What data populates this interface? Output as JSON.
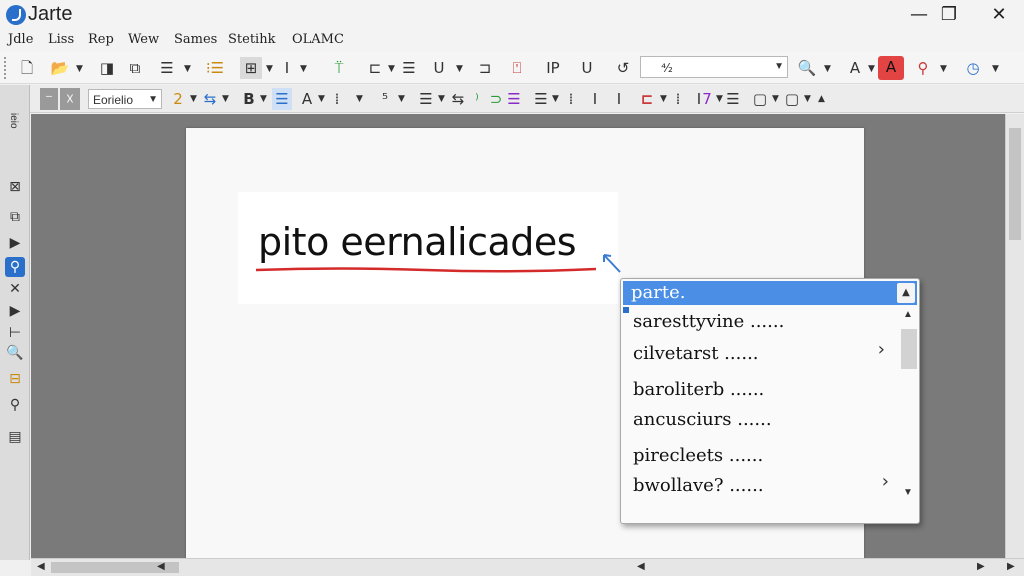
{
  "window": {
    "title": "Jarte",
    "minimize_glyph": "—",
    "maximize_glyph": "❐",
    "close_glyph": "✕"
  },
  "menu": [
    "Jdle",
    "Liss",
    "Rep",
    "Wew",
    "Sames",
    "Stetihk",
    "OLAMC"
  ],
  "toolbar1": {
    "font_combo_value": "",
    "tool_glyphs": [
      "🗋",
      "📂",
      "◨",
      "⧉",
      "☰",
      "⁝☰",
      "⊞",
      "I",
      "⍡",
      "⊏",
      "☰",
      "U",
      "⊐",
      "⍞",
      "IP",
      "U",
      "↺",
      "⁴⁄₂",
      "🔍",
      "A",
      "A",
      "⚲",
      "◷"
    ]
  },
  "toolbar2": {
    "style_combo_value": "Eorielio",
    "tool_glyphs": [
      "⁻",
      "☓",
      "2",
      "⇆",
      "B",
      "☰",
      "A",
      "⁞",
      "⁵",
      "☰",
      "⇆",
      "⁾",
      "⊃",
      "☰",
      "☰",
      "⁞",
      "I",
      "I",
      "⊏",
      "⁞",
      "I",
      "7",
      "☰",
      "▢"
    ]
  },
  "leftbar": {
    "vertical_label": "ieio",
    "tool_glyphs": [
      "⊠",
      "⧉",
      "▶",
      "⚲",
      "✕",
      "▶",
      "⊢",
      "🔍",
      "⊟",
      "⚲",
      "▤"
    ]
  },
  "document": {
    "misspelled_text": "pito eernalicades"
  },
  "suggestions": {
    "selected": "parte.",
    "items": [
      {
        "label": "saresttyvine ......",
        "has_submenu": false
      },
      {
        "label": "cilvetarst ......",
        "has_submenu": true
      },
      {
        "label": "baroliterb ......",
        "has_submenu": false
      },
      {
        "label": "ancusciurs ......",
        "has_submenu": false
      },
      {
        "label": "pirecleets ......",
        "has_submenu": false
      },
      {
        "label": "bwollave? ......",
        "has_submenu": true
      }
    ],
    "submenu_glyph": "›"
  },
  "colors": {
    "accent": "#4a8ee6",
    "squiggle": "#d42a2a",
    "workspace": "#7a7a7a"
  }
}
